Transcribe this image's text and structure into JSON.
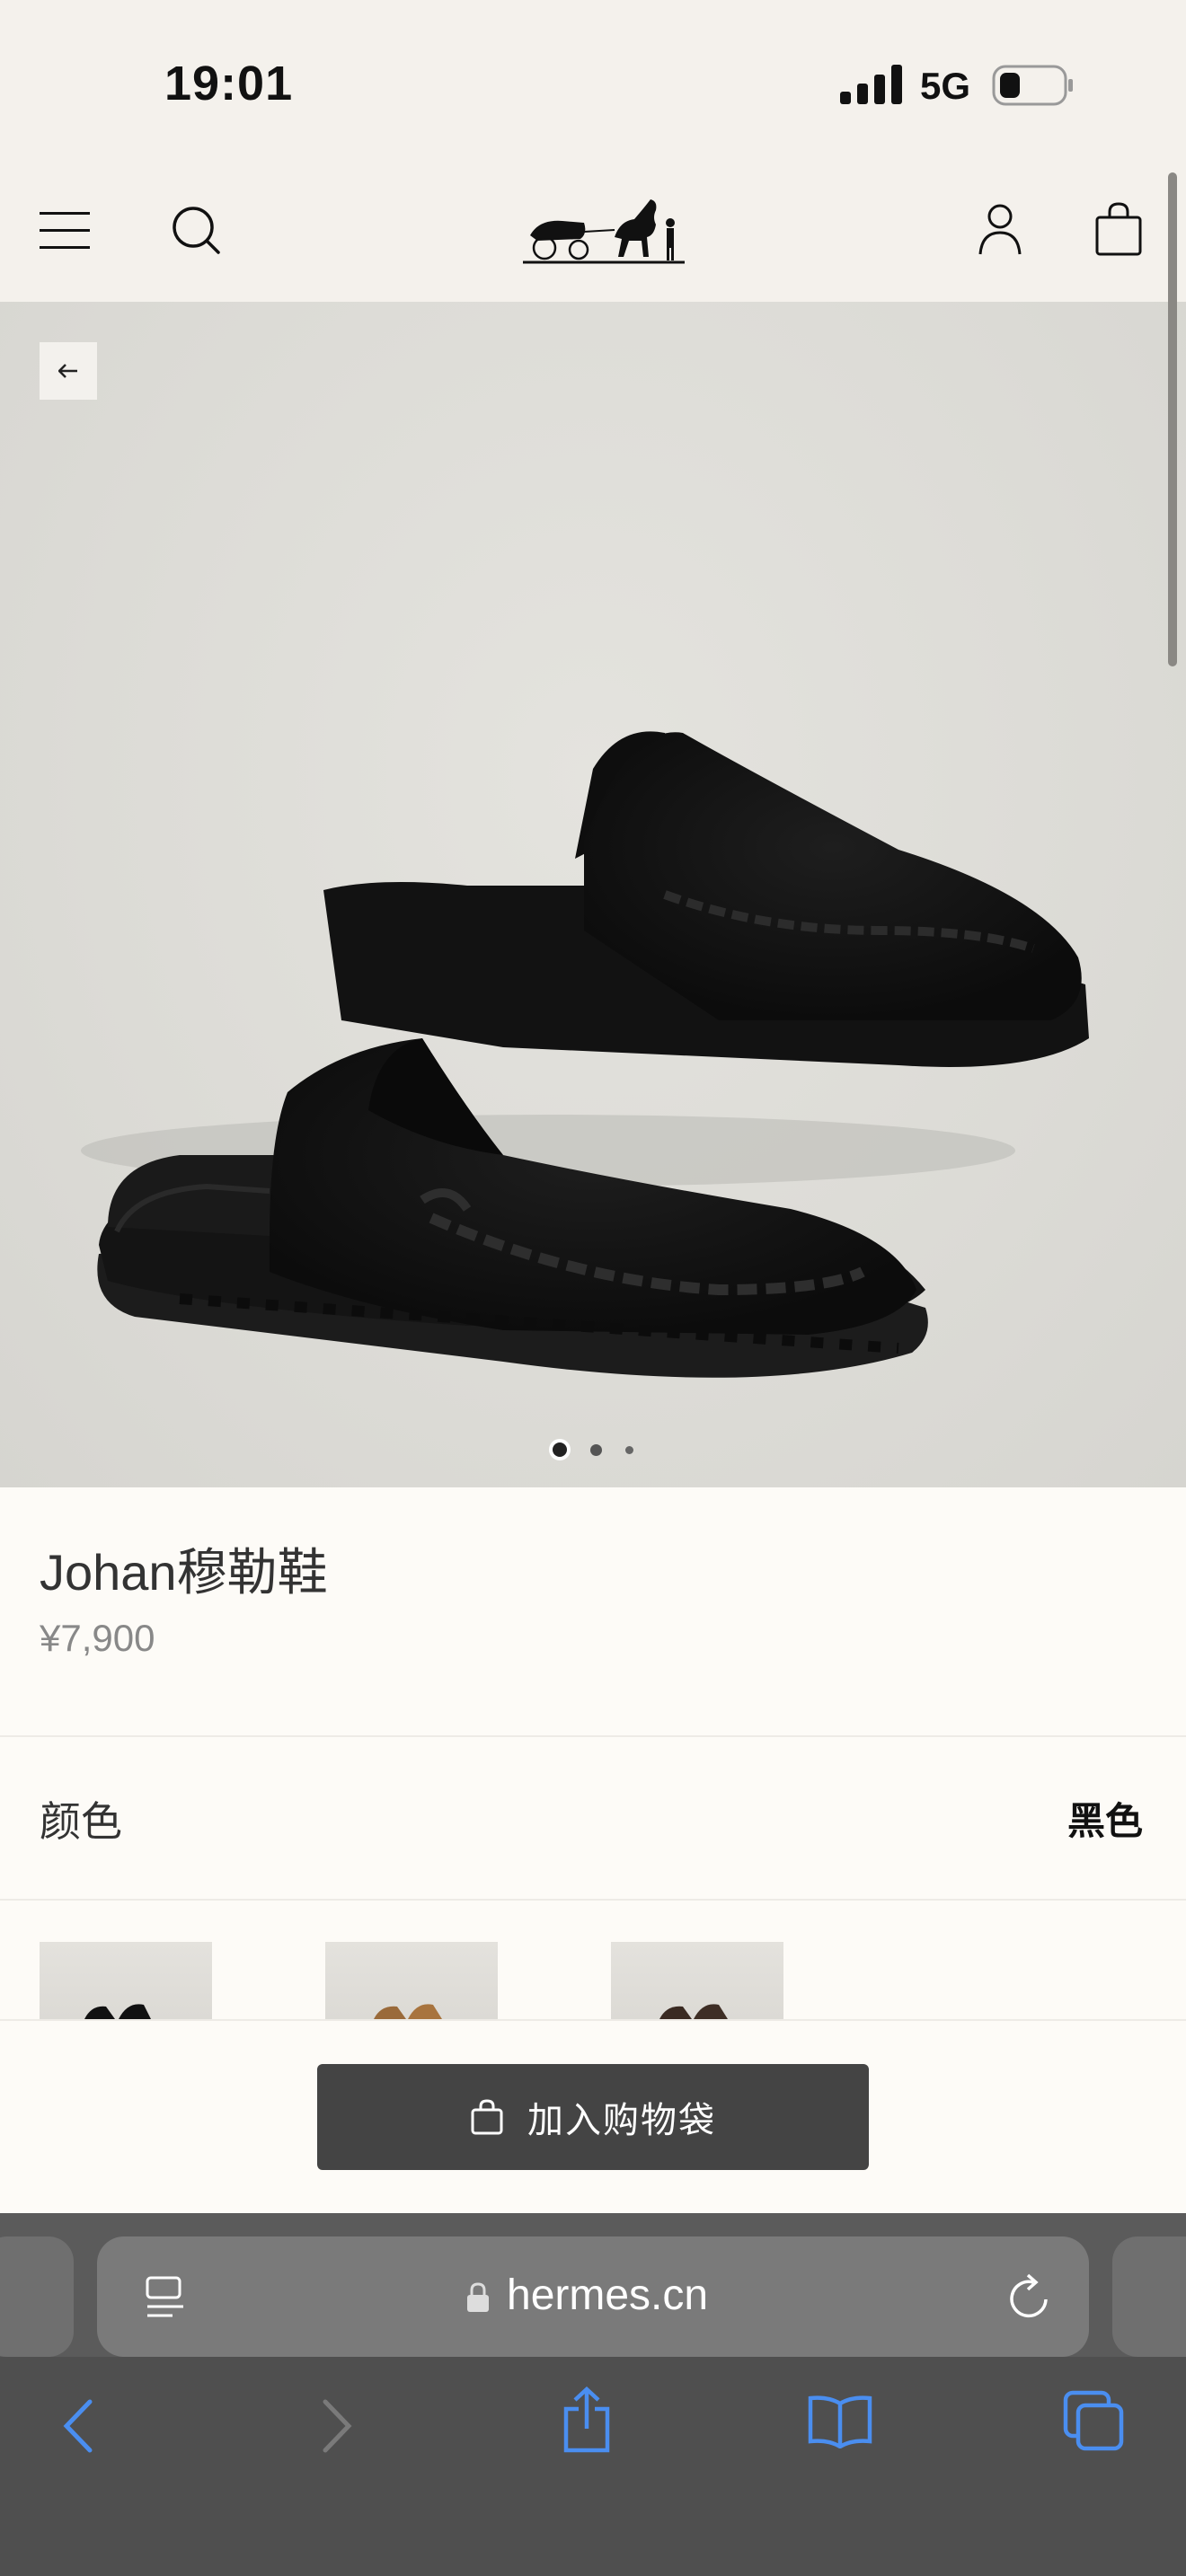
{
  "status_bar": {
    "time": "19:01",
    "network": "5G"
  },
  "header": {
    "menu_icon": "menu-icon",
    "search_icon": "search-icon",
    "logo": "hermes-carriage-logo",
    "account_icon": "account-icon",
    "bag_icon": "shopping-bag-icon"
  },
  "gallery": {
    "back_icon": "arrow-left-icon",
    "image_count": 3,
    "active_index": 0
  },
  "product": {
    "title": "Johan穆勒鞋",
    "price": "¥7,900"
  },
  "color_selector": {
    "label": "颜色",
    "selected": "黑色",
    "swatches": [
      "black",
      "brown",
      "dark-brown"
    ]
  },
  "actions": {
    "add_to_bag": "加入购物袋"
  },
  "browser": {
    "url": "hermes.cn",
    "toolbar": [
      "back",
      "forward",
      "share",
      "bookmarks",
      "tabs"
    ]
  },
  "colors": {
    "header_bg": "#f4f1ec",
    "page_bg": "#fdfbf7",
    "button_bg": "#444444",
    "browser_bg": "#5b5b5b",
    "browser_accent": "#4a8ef0"
  }
}
